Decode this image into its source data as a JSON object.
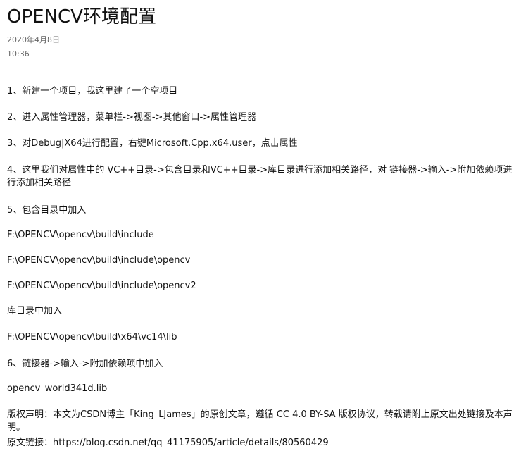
{
  "note": {
    "title": "OPENCV环境配置",
    "date": "2020年4月8日",
    "time": "10:36"
  },
  "content": {
    "step1": "1、新建一个项目，我这里建了一个空项目",
    "step2": "2、进入属性管理器，菜单栏->视图->其他窗口->属性管理器",
    "step3": "3、对Debug|X64进行配置，右键Microsoft.Cpp.x64.user，点击属性",
    "step4": "4、这里我们对属性中的 VC++目录->包含目录和VC++目录->库目录进行添加相关路径，对 链接器->输入->附加依赖项进行添加相关路径",
    "step5": "5、包含目录中加入",
    "include_path_1": "F:\\OPENCV\\opencv\\build\\include",
    "include_path_2": "F:\\OPENCV\\opencv\\build\\include\\opencv",
    "include_path_3": "F:\\OPENCV\\opencv\\build\\include\\opencv2",
    "lib_dir_heading": "库目录中加入",
    "lib_path": "F:\\OPENCV\\opencv\\build\\x64\\vc14\\lib",
    "step6": "6、链接器->输入->附加依赖项中加入",
    "lib_file": "opencv_world341d.lib",
    "separator": "————————————————",
    "copyright": "版权声明：本文为CSDN博主「King_LJames」的原创文章，遵循 CC 4.0 BY-SA 版权协议，转载请附上原文出处链接及本声明。",
    "source_link": "原文链接：https://blog.csdn.net/qq_41175905/article/details/80560429"
  }
}
